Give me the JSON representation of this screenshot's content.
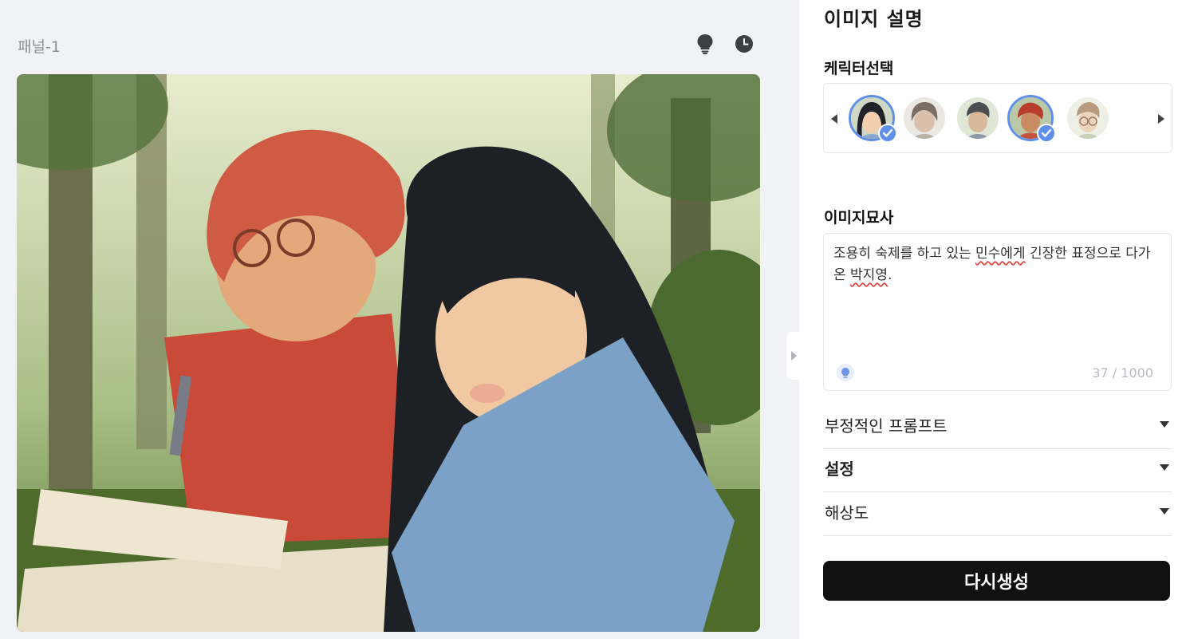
{
  "panel": {
    "title": "패널-1",
    "icons": [
      "lightbulb-icon",
      "history-clock-icon"
    ],
    "image_alt": "illustration"
  },
  "sidebar": {
    "heading": "이미지 설명",
    "character_label": "케릭터선택",
    "characters": [
      {
        "name": "character-1",
        "selected": true
      },
      {
        "name": "character-2",
        "selected": false
      },
      {
        "name": "character-3",
        "selected": false
      },
      {
        "name": "character-4",
        "selected": true
      },
      {
        "name": "character-5",
        "selected": false
      }
    ],
    "description_label": "이미지묘사",
    "description": {
      "part1": "조용히 숙제를 하고 있는 ",
      "misspelled1": "민수에게",
      "part2": " 긴장한 표정으로 다가온 ",
      "misspelled2": "박지영",
      "part3": "."
    },
    "counter": "37 / 1000",
    "accordions": [
      {
        "label": "부정적인 프롬프트"
      },
      {
        "label": "설정"
      },
      {
        "label": "해상도"
      }
    ],
    "regenerate_label": "다시생성"
  },
  "colors": {
    "accent": "#5f8fe8",
    "button_bg": "#111111",
    "left_bg": "#f1f2f6"
  }
}
